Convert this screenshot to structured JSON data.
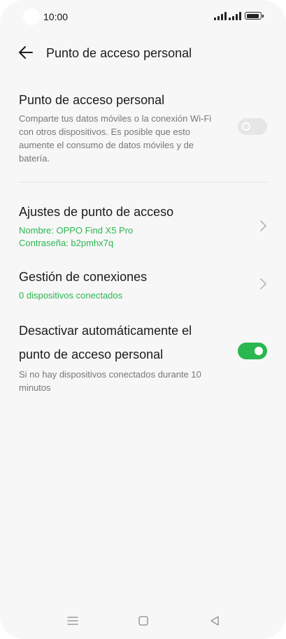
{
  "status_bar": {
    "time": "10:00",
    "battery_level": 0.95
  },
  "header": {
    "title": "Punto de acceso personal",
    "back_icon": "arrow-left-icon"
  },
  "hotspot": {
    "title": "Punto de acceso personal",
    "description": "Comparte tus datos móviles o la conexión Wi-Fi con otros dispositivos. Es posible que esto aumente el consumo de datos móviles y de batería.",
    "enabled": false
  },
  "settings": {
    "title": "Ajustes de punto de acceso",
    "name_line": "Nombre: OPPO Find X5 Pro",
    "password_line": "Contraseña: b2pmhx7q"
  },
  "connections": {
    "title": "Gestión de conexiones",
    "subtitle": "0 dispositivos conectados"
  },
  "auto_off": {
    "title": "Desactivar automáticamente el punto de acceso personal",
    "subtitle": "Si no hay dispositivos conectados durante 10 minutos",
    "enabled": true
  },
  "colors": {
    "accent_green": "#2ab750",
    "background": "#f7f7f7",
    "text_primary": "#1b1b1b",
    "text_secondary": "#777777"
  },
  "nav_bar": {
    "icons": [
      "menu-icon",
      "home-icon",
      "back-triangle-icon"
    ]
  }
}
